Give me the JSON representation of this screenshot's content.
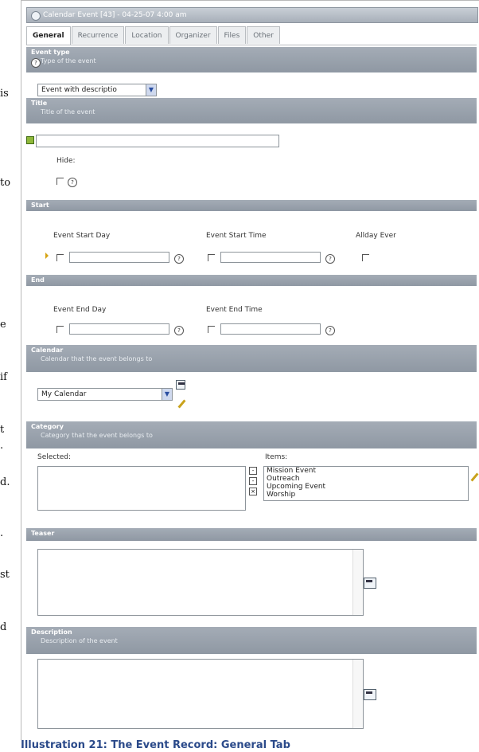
{
  "left_fragments": [
    "is",
    "to",
    "e",
    "if",
    "t",
    ".",
    "d.",
    ".",
    "st",
    "d"
  ],
  "window": {
    "title": "Calendar Event [43] - 04-25-07 4:00 am"
  },
  "tabs": [
    {
      "label": "General",
      "active": true
    },
    {
      "label": "Recurrence",
      "active": false
    },
    {
      "label": "Location",
      "active": false
    },
    {
      "label": "Organizer",
      "active": false
    },
    {
      "label": "Files",
      "active": false
    },
    {
      "label": "Other",
      "active": false
    }
  ],
  "event_type": {
    "header": "Event type",
    "desc": "Type of the event",
    "value": "Event with descriptio"
  },
  "title_section": {
    "header": "Title",
    "desc": "Title of the event",
    "value": ""
  },
  "hide_label": "Hide:",
  "start": {
    "header": "Start",
    "day_label": "Event Start Day",
    "time_label": "Event Start Time",
    "allday_label": "Allday Ever"
  },
  "end": {
    "header": "End",
    "day_label": "Event End Day",
    "time_label": "Event End Time"
  },
  "calendar": {
    "header": "Calendar",
    "desc": "Calendar that the event belongs to",
    "value": "My Calendar"
  },
  "category": {
    "header": "Category",
    "desc": "Category that the event belongs to",
    "selected_label": "Selected:",
    "items_label": "Items:",
    "items": [
      "Mission Event",
      "Outreach",
      "Upcoming Event",
      "Worship"
    ]
  },
  "teaser": {
    "header": "Teaser"
  },
  "description": {
    "header": "Description",
    "desc": "Description of the event"
  },
  "caption": "Illustration 21: The Event Record: General Tab",
  "colors": {
    "header": "#99a1ac",
    "caption": "#2b4a8a"
  }
}
